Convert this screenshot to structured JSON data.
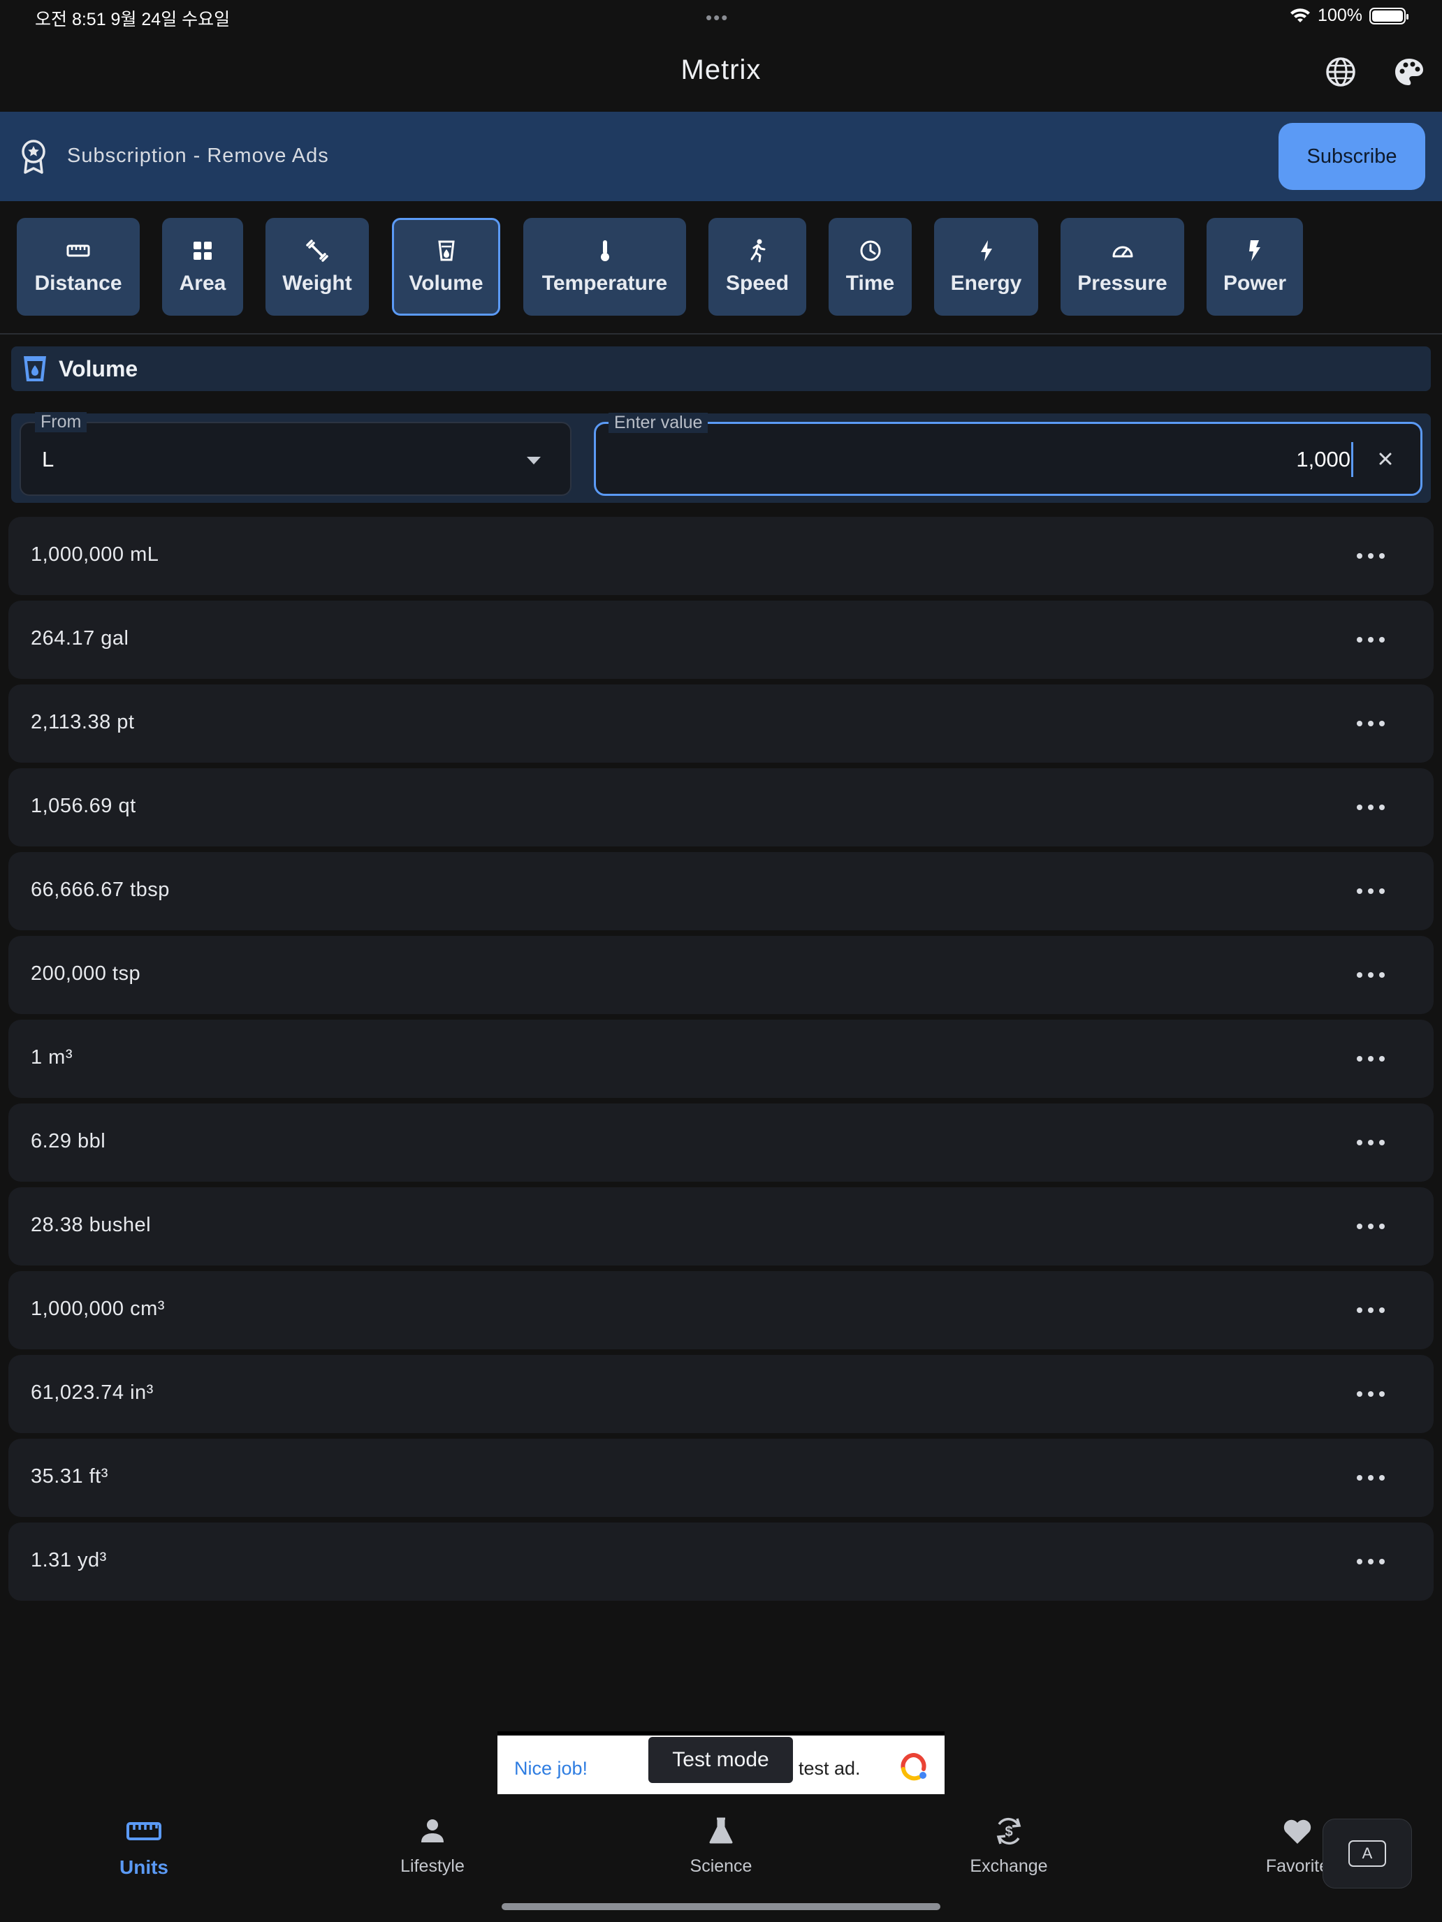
{
  "status_bar": {
    "time": "오전 8:51   9월 24일 수요일",
    "battery": "100%"
  },
  "app": {
    "title": "Metrix",
    "icons": [
      "globe-icon",
      "palette-icon"
    ]
  },
  "banner": {
    "text": "Subscription - Remove Ads",
    "button": "Subscribe"
  },
  "categories": [
    {
      "label": "Distance",
      "icon": "ruler-icon"
    },
    {
      "label": "Area",
      "icon": "grid-icon"
    },
    {
      "label": "Weight",
      "icon": "dumbbell-icon"
    },
    {
      "label": "Volume",
      "icon": "cup-icon",
      "active": true
    },
    {
      "label": "Temperature",
      "icon": "thermometer-icon"
    },
    {
      "label": "Speed",
      "icon": "runner-icon"
    },
    {
      "label": "Time",
      "icon": "clock-icon"
    },
    {
      "label": "Energy",
      "icon": "bolt-icon"
    },
    {
      "label": "Pressure",
      "icon": "gauge-icon"
    },
    {
      "label": "Power",
      "icon": "power-bolt-icon"
    }
  ],
  "section": {
    "title": "Volume"
  },
  "converter": {
    "from_label": "From",
    "from_value": "L",
    "value_label": "Enter value",
    "value": "1,000"
  },
  "results": [
    "1,000,000 mL",
    "264.17 gal",
    "2,113.38 pt",
    "1,056.69 qt",
    "66,666.67 tbsp",
    "200,000 tsp",
    "1 m³",
    "6.29 bbl",
    "28.38 bushel",
    "1,000,000 cm³",
    "61,023.74 in³",
    "35.31 ft³",
    "1.31 yd³"
  ],
  "ad": {
    "left_text": "Nice job!",
    "right_text": "test ad.",
    "overlay": "Test mode"
  },
  "bottom_nav": [
    {
      "label": "Units",
      "icon": "ruler-icon",
      "active": true
    },
    {
      "label": "Lifestyle",
      "icon": "person-icon"
    },
    {
      "label": "Science",
      "icon": "flask-icon"
    },
    {
      "label": "Exchange",
      "icon": "currency-exchange-icon"
    },
    {
      "label": "Favorite",
      "icon": "heart-icon"
    }
  ],
  "keyboard_button": "A",
  "colors": {
    "accent": "#5b9af5",
    "banner": "#1f3a60",
    "tab": "#29405f",
    "background": "#121212"
  }
}
